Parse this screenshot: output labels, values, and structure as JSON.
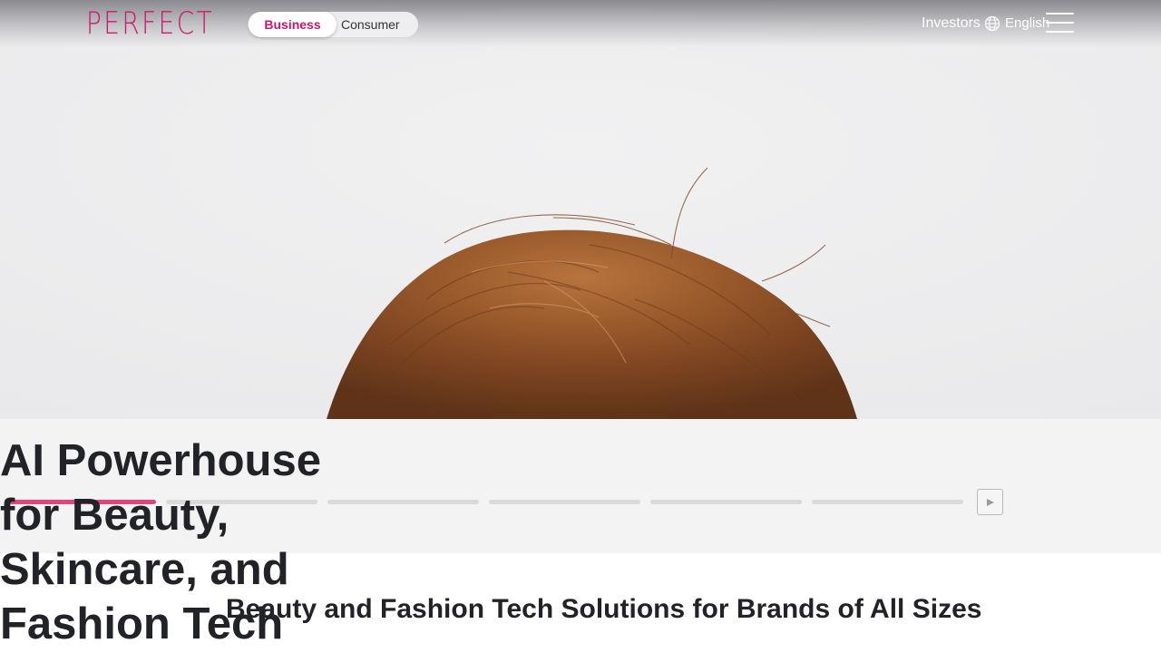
{
  "header": {
    "logo_text": "PERFECT",
    "segments": [
      {
        "label": "Business",
        "active": true
      },
      {
        "label": "Consumer",
        "active": false
      }
    ],
    "investors_label": "Investors",
    "language_label": "English",
    "icons": {
      "language": "globe-icon",
      "menu": "hamburger-menu-icon"
    }
  },
  "hero": {
    "headline": "AI Powerhouse for Beauty, Skincare, and Fashion Tech",
    "progress_segments": [
      {
        "fill": 1.0
      },
      {
        "fill": 0.0
      },
      {
        "fill": 0.0
      },
      {
        "fill": 0.0
      },
      {
        "fill": 0.0
      },
      {
        "fill": 0.0
      }
    ],
    "play_icon": "play-icon"
  },
  "section": {
    "title": "Beauty and Fashion Tech Solutions for Brands of All Sizes"
  },
  "colors": {
    "brand": "#cc1a72",
    "progress_active": "#e0457b",
    "progress_track": "#dadada",
    "band_background": "#f3f3f3",
    "text_dark": "#222328"
  }
}
